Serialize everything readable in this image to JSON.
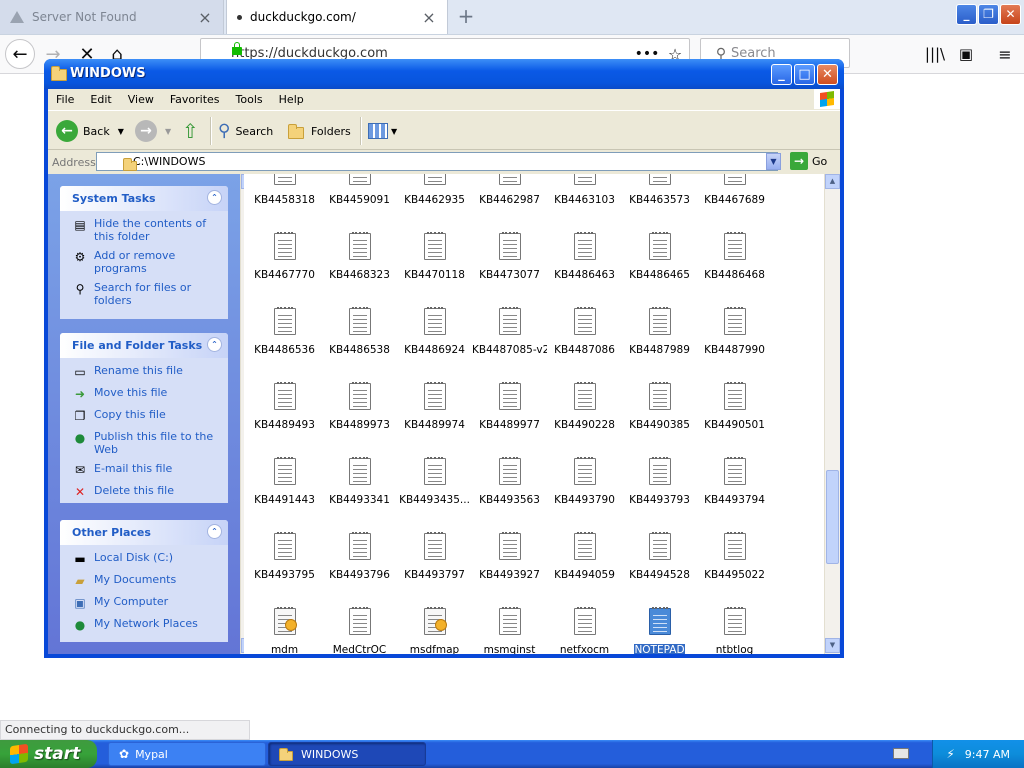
{
  "browser": {
    "tabs": [
      {
        "label": "Server Not Found",
        "active": false
      },
      {
        "label": "duckduckgo.com/",
        "active": true
      }
    ],
    "url": "https://duckduckgo.com",
    "search_placeholder": "Search",
    "status_text": "Connecting to duckduckgo.com..."
  },
  "explorer": {
    "title": "WINDOWS",
    "menu": [
      "File",
      "Edit",
      "View",
      "Favorites",
      "Tools",
      "Help"
    ],
    "toolbar": {
      "back": "Back",
      "search": "Search",
      "folders": "Folders"
    },
    "address_label": "Address",
    "address_value": "C:\\WINDOWS",
    "go_label": "Go",
    "panels": [
      {
        "title": "System Tasks",
        "items": [
          {
            "label": "Hide the contents of this folder",
            "icon": "hide-icon"
          },
          {
            "label": "Add or remove programs",
            "icon": "programs-icon"
          },
          {
            "label": "Search for files or folders",
            "icon": "search-icon"
          }
        ]
      },
      {
        "title": "File and Folder Tasks",
        "items": [
          {
            "label": "Rename this file",
            "icon": "rename-icon"
          },
          {
            "label": "Move this file",
            "icon": "move-icon"
          },
          {
            "label": "Copy this file",
            "icon": "copy-icon"
          },
          {
            "label": "Publish this file to the Web",
            "icon": "publish-icon"
          },
          {
            "label": "E-mail this file",
            "icon": "email-icon"
          },
          {
            "label": "Delete this file",
            "icon": "delete-icon"
          }
        ]
      },
      {
        "title": "Other Places",
        "items": [
          {
            "label": "Local Disk (C:)",
            "icon": "disk-icon"
          },
          {
            "label": "My Documents",
            "icon": "documents-icon"
          },
          {
            "label": "My Computer",
            "icon": "computer-icon"
          },
          {
            "label": "My Network Places",
            "icon": "network-icon"
          }
        ]
      }
    ],
    "files": [
      {
        "name": "KB4458318",
        "type": "text"
      },
      {
        "name": "KB4459091",
        "type": "text"
      },
      {
        "name": "KB4462935",
        "type": "text"
      },
      {
        "name": "KB4462987",
        "type": "text"
      },
      {
        "name": "KB4463103",
        "type": "text"
      },
      {
        "name": "KB4463573",
        "type": "text"
      },
      {
        "name": "KB4467689",
        "type": "text"
      },
      {
        "name": "KB4467770",
        "type": "text"
      },
      {
        "name": "KB4468323",
        "type": "text"
      },
      {
        "name": "KB4470118",
        "type": "text"
      },
      {
        "name": "KB4473077",
        "type": "text"
      },
      {
        "name": "KB4486463",
        "type": "text"
      },
      {
        "name": "KB4486465",
        "type": "text"
      },
      {
        "name": "KB4486468",
        "type": "text"
      },
      {
        "name": "KB4486536",
        "type": "text"
      },
      {
        "name": "KB4486538",
        "type": "text"
      },
      {
        "name": "KB4486924",
        "type": "text"
      },
      {
        "name": "KB4487085-v2",
        "type": "text"
      },
      {
        "name": "KB4487086",
        "type": "text"
      },
      {
        "name": "KB4487989",
        "type": "text"
      },
      {
        "name": "KB4487990",
        "type": "text"
      },
      {
        "name": "KB4489493",
        "type": "text"
      },
      {
        "name": "KB4489973",
        "type": "text"
      },
      {
        "name": "KB4489974",
        "type": "text"
      },
      {
        "name": "KB4489977",
        "type": "text"
      },
      {
        "name": "KB4490228",
        "type": "text"
      },
      {
        "name": "KB4490385",
        "type": "text"
      },
      {
        "name": "KB4490501",
        "type": "text"
      },
      {
        "name": "KB4491443",
        "type": "text"
      },
      {
        "name": "KB4493341",
        "type": "text"
      },
      {
        "name": "KB4493435...",
        "type": "text"
      },
      {
        "name": "KB4493563",
        "type": "text"
      },
      {
        "name": "KB4493790",
        "type": "text"
      },
      {
        "name": "KB4493793",
        "type": "text"
      },
      {
        "name": "KB4493794",
        "type": "text"
      },
      {
        "name": "KB4493795",
        "type": "text"
      },
      {
        "name": "KB4493796",
        "type": "text"
      },
      {
        "name": "KB4493797",
        "type": "text"
      },
      {
        "name": "KB4493927",
        "type": "text"
      },
      {
        "name": "KB4494059",
        "type": "text"
      },
      {
        "name": "KB4494528",
        "type": "text"
      },
      {
        "name": "KB4495022",
        "type": "text"
      },
      {
        "name": "mdm",
        "type": "gear"
      },
      {
        "name": "MedCtrOC",
        "type": "text"
      },
      {
        "name": "msdfmap",
        "type": "gear"
      },
      {
        "name": "msmqinst",
        "type": "text"
      },
      {
        "name": "netfxocm",
        "type": "text"
      },
      {
        "name": "NOTEPAD",
        "type": "notepad",
        "selected": true
      },
      {
        "name": "ntbtlog",
        "type": "text"
      }
    ]
  },
  "taskbar": {
    "start_label": "start",
    "tasks": [
      {
        "label": "Mypal",
        "active": false
      },
      {
        "label": "WINDOWS",
        "active": true
      }
    ],
    "clock": "9:47 AM"
  }
}
